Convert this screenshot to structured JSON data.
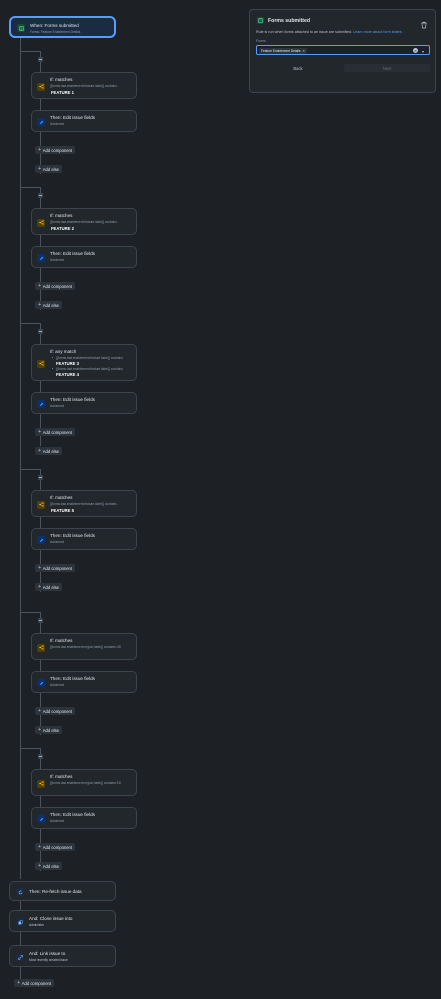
{
  "trigger": {
    "title": "When: Forms submitted",
    "subtitle": "Forms: Feature Enablement Details",
    "icon": "form-icon"
  },
  "panel": {
    "title": "Forms submitted",
    "description": "Rule is run when forms attached to an issue are submitted.",
    "link": "Learn more about form states.",
    "field_label": "Forms",
    "selected_chip": "Feature Enablement Details",
    "back_label": "Back",
    "next_label": "Next",
    "accent": "#1f845a"
  },
  "branches": [
    {
      "if": {
        "title": "If: matches",
        "condition": "{{forms.last.enablement.feature.label}} contains",
        "values": [
          "FEATURE 1"
        ]
      },
      "then": {
        "title": "Then: Edit issue fields",
        "subtitle": "Advanced"
      },
      "add_component": "Add component",
      "add_else": "Add else"
    },
    {
      "if": {
        "title": "If: matches",
        "condition": "{{forms.last.enablement.feature.label}} contains",
        "values": [
          "FEATURE 2"
        ]
      },
      "then": {
        "title": "Then: Edit issue fields",
        "subtitle": "Advanced"
      },
      "add_component": "Add component",
      "add_else": "Add else"
    },
    {
      "if": {
        "title": "If: any match",
        "items": [
          {
            "condition": "{{forms.last.enablement.feature.label}} contains",
            "value": "FEATURE 3"
          },
          {
            "condition": "{{forms.last.enablement.feature.label}} contains",
            "value": "FEATURE 4"
          }
        ]
      },
      "then": {
        "title": "Then: Edit issue fields",
        "subtitle": "Advanced"
      },
      "add_component": "Add component",
      "add_else": "Add else"
    },
    {
      "if": {
        "title": "If: matches",
        "condition": "{{forms.last.enablement.feature.label}} contains",
        "values": [
          "FEATURE 5"
        ]
      },
      "then": {
        "title": "Then: Edit issue fields",
        "subtitle": "Advanced"
      },
      "add_component": "Add component",
      "add_else": "Add else"
    },
    {
      "if": {
        "title": "If: matches",
        "condition": "{{forms.last.enablement.region.label}} contains US"
      },
      "then": {
        "title": "Then: Edit issue fields",
        "subtitle": "Advanced"
      },
      "add_component": "Add component",
      "add_else": "Add else"
    },
    {
      "if": {
        "title": "If: matches",
        "condition": "{{forms.last.enablement.region.label}} contains EU"
      },
      "then": {
        "title": "Then: Edit issue fields",
        "subtitle": "Advanced"
      },
      "add_component": "Add component",
      "add_else": "Add else"
    }
  ],
  "actions": [
    {
      "title": "Then: Re-fetch issue data",
      "icon": "refresh-icon"
    },
    {
      "title": "And: Clone issue into",
      "subtitle": "Administer",
      "icon": "clone-icon"
    },
    {
      "title": "And: Link issue to",
      "subtitle": "Most recently created issue",
      "icon": "link-icon"
    }
  ],
  "final_add_component": "Add component"
}
